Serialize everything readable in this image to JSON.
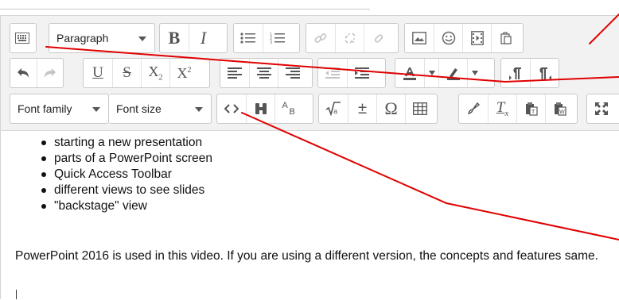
{
  "toolbar": {
    "row1": {
      "block_format": "Paragraph",
      "buttons": [
        "toolbar-toggle",
        "bold",
        "italic",
        "bullet-list",
        "numbered-list",
        "insert-link",
        "remove-link",
        "anchor",
        "insert-image",
        "emoticon",
        "insert-media",
        "manage-files"
      ],
      "bold_label": "B",
      "italic_label": "I"
    },
    "row2": {
      "buttons": [
        "undo",
        "redo",
        "underline",
        "strikethrough",
        "subscript",
        "superscript",
        "align-left",
        "align-center",
        "align-right",
        "outdent",
        "indent",
        "text-color",
        "background-color",
        "ltr",
        "rtl"
      ],
      "underline_label": "U",
      "strike_label": "S",
      "subscript_label": "X",
      "subscript_suffix": "2",
      "superscript_label": "X",
      "superscript_suffix": "2"
    },
    "row3": {
      "font_family": "Font family",
      "font_size": "Font size",
      "buttons": [
        "html-source",
        "find-replace",
        "spell-case",
        "equation",
        "special-character-plusminus",
        "special-character-omega",
        "table",
        "clean-formatting",
        "clear-formatting",
        "paste-text",
        "paste-word",
        "fullscreen"
      ],
      "spell_label_a": "A",
      "spell_label_b": "B",
      "omega": "Ω",
      "plusminus": "±",
      "clear_label": "T",
      "clear_sub": "x"
    }
  },
  "content": {
    "bullets": [
      "starting a new presentation",
      "parts of a PowerPoint screen",
      "Quick Access Toolbar",
      "different views to see slides",
      "\"backstage\" view"
    ],
    "paragraph": "PowerPoint 2016 is used in this video. If you are using a different version, the concepts and features same."
  },
  "colors": {
    "toolbar_bg": "#f2f2f2",
    "annotation_line": "#e00000",
    "icon": "#555555",
    "disabled_icon": "#c4c4c4"
  }
}
